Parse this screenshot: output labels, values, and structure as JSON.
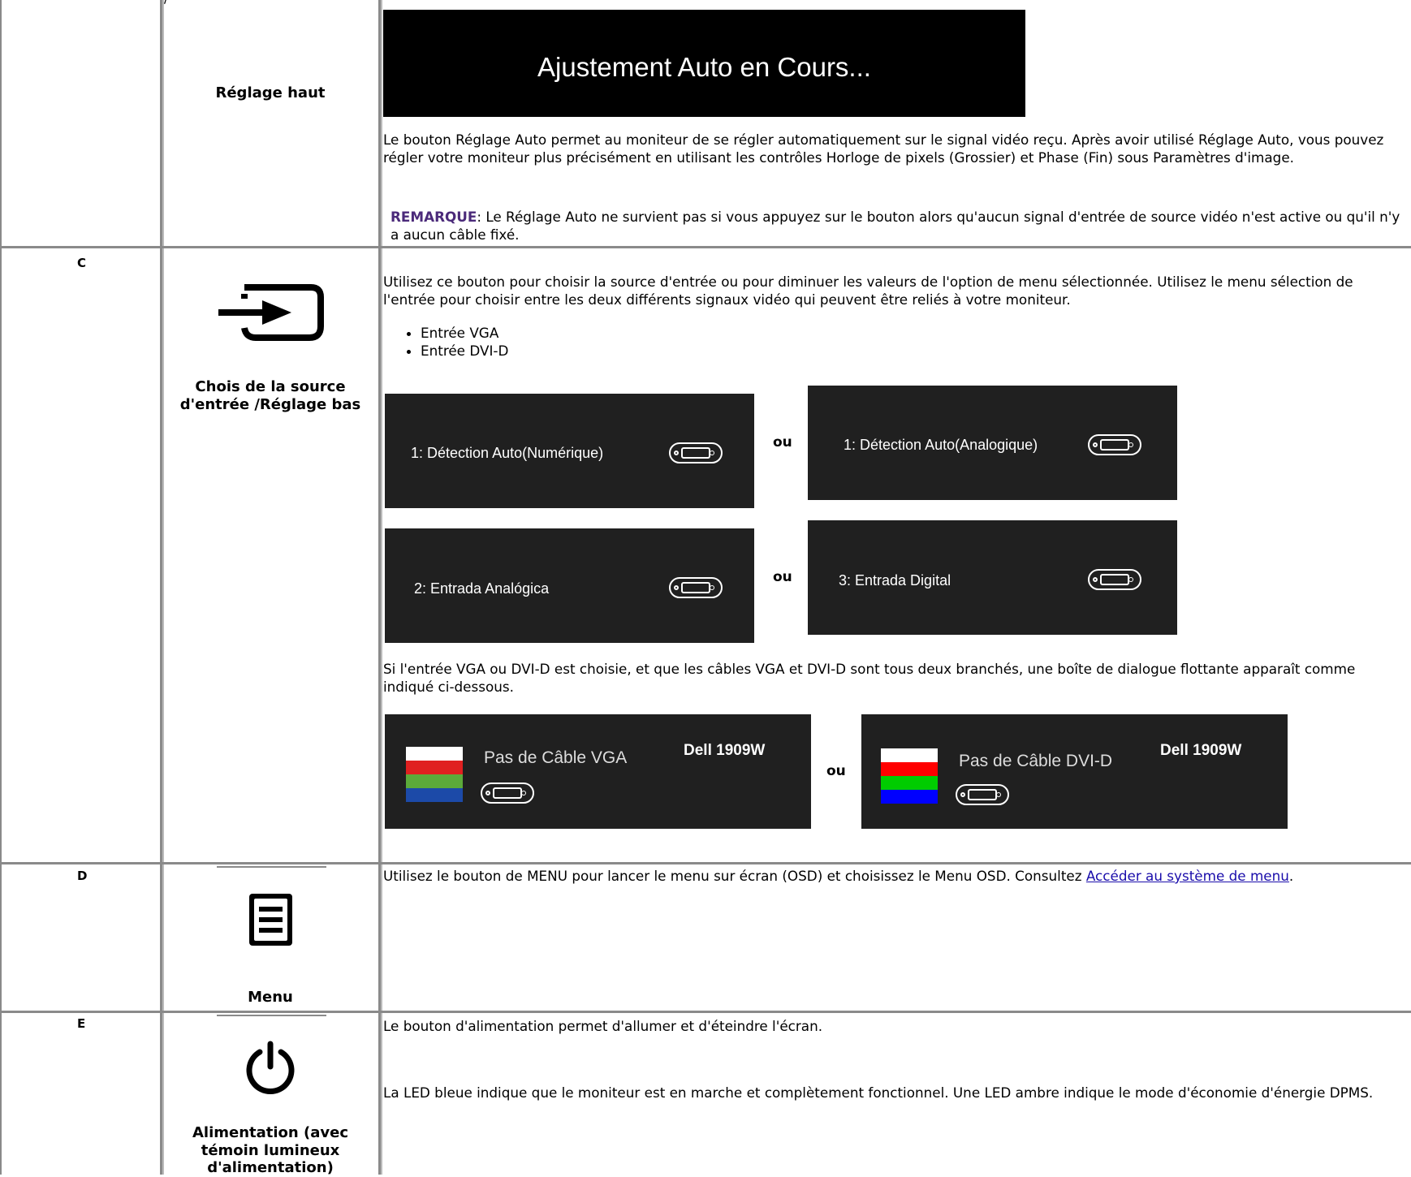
{
  "top_fragment": "/",
  "rows": {
    "b": {
      "caption": "Réglage haut",
      "osd_text": "Ajustement Auto en Cours...",
      "description": "Le bouton Réglage Auto permet au moniteur de se régler automatiquement sur le signal vidéo reçu. Après avoir utilisé Réglage Auto, vous pouvez régler votre moniteur plus précisément en utilisant les contrôles Horloge de pixels (Grossier) et Phase (Fin) sous Paramètres d'image.",
      "note_label": "REMARQUE",
      "note_text": ": Le Réglage Auto ne survient pas si vous appuyez sur le bouton alors qu'aucun signal d'entrée de source vidéo n'est active ou qu'il n'y a aucun câble fixé."
    },
    "c": {
      "letter": "C",
      "icon": "input-source-icon",
      "caption": "Chois de la source d'entrée /Réglage bas",
      "description": "Utilisez ce bouton pour choisir la source d'entrée ou pour diminuer les valeurs de l'option de menu sélectionnée. Utilisez le menu sélection de l'entrée pour choisir entre les deux différents signaux vidéo qui peuvent être reliés à votre moniteur.",
      "inputs": [
        "Entrée VGA",
        "Entrée DVI-D"
      ],
      "osd_1_label": "1:  Détection Auto(Numérique)",
      "osd_2_label": "1:  Détection Auto(Analogique)",
      "osd_3_label": "2: Entrada Analógica",
      "osd_4_label": "3: Entrada Digital",
      "or_label": "ou",
      "cable_description": "Si l'entrée VGA ou DVI-D est choisie, et que les câbles VGA et DVI-D sont tous deux branchés, une boîte de dialogue flottante apparaît comme indiqué ci-dessous.",
      "no_cable_vga": "Pas de Câble VGA",
      "no_cable_dvi": "Pas de Câble DVI-D",
      "model": "Dell 1909W"
    },
    "d": {
      "letter": "D",
      "icon": "menu-icon",
      "caption": "Menu",
      "description_before": "Utilisez le bouton de MENU pour lancer le menu sur écran (OSD) et choisissez le Menu OSD. Consultez ",
      "link_text": "Accéder au système de menu",
      "description_after": "."
    },
    "e": {
      "letter": "E",
      "icon": "power-icon",
      "caption": "Alimentation (avec témoin lumineux d'alimentation)",
      "description_1": "Le bouton d'alimentation permet d'allumer et d'éteindre l'écran.",
      "description_2": "La LED bleue indique que le moniteur est en marche et complètement fonctionnel. Une LED ambre indique le mode d'économie d'énergie DPMS."
    }
  },
  "colors": {
    "grid": "#8a8a8a",
    "note": "#4b2a7a",
    "osd_bg": "#202020",
    "vga_bars": [
      "#ffffff",
      "#e02020",
      "#5caa3a",
      "#1c4aa8"
    ],
    "dvi_bars": [
      "#ffffff",
      "#ff0000",
      "#00cc00",
      "#0000ff"
    ]
  }
}
